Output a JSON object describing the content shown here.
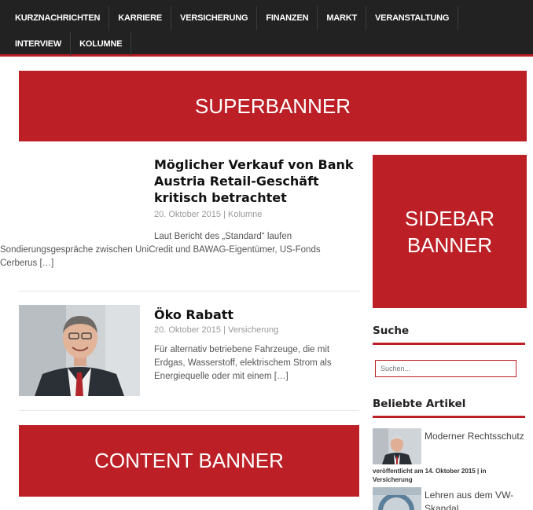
{
  "nav": {
    "row1": [
      "KURZNACHRICHTEN",
      "KARRIERE",
      "VERSICHERUNG",
      "FINANZEN",
      "MARKT",
      "VERANSTALTUNG"
    ],
    "row2": [
      "INTERVIEW",
      "KOLUMNE"
    ]
  },
  "banners": {
    "super": "SUPERBANNER",
    "sidebar_line1": "SIDEBAR",
    "sidebar_line2": "BANNER",
    "content": "CONTENT BANNER"
  },
  "articles": [
    {
      "title": "Möglicher Verkauf von Bank Austria Retail-Geschäft kritisch betrachtet",
      "date": "20. Oktober 2015",
      "separator": "|",
      "category": "Kolumne",
      "excerpt": "Laut Bericht des „Standard“ laufen Sondierungsgespräche zwischen UniCredit und BAWAG-Eigentümer, US-Fonds Cerberus […]"
    },
    {
      "title": "Öko Rabatt",
      "date": "20. Oktober 2015",
      "separator": "|",
      "category": "Versicherung",
      "excerpt": "Für alternativ betriebene Fahrzeuge, die mit Erdgas, Wasserstoff, elektrischem Strom als Energiequelle oder mit einem […]"
    }
  ],
  "sidebar": {
    "search_heading": "Suche",
    "search_placeholder": "Suchen...",
    "popular_heading": "Beliebte Artikel",
    "popular": [
      {
        "title": "Moderner Rechtsschutz",
        "meta": "veröffentlicht am 14. Oktober 2015 | in Versicherung"
      },
      {
        "title": "Lehren aus dem VW-Skandal",
        "meta": ""
      }
    ]
  },
  "colors": {
    "accent": "#bc1f25",
    "nav_bg": "#222222"
  }
}
